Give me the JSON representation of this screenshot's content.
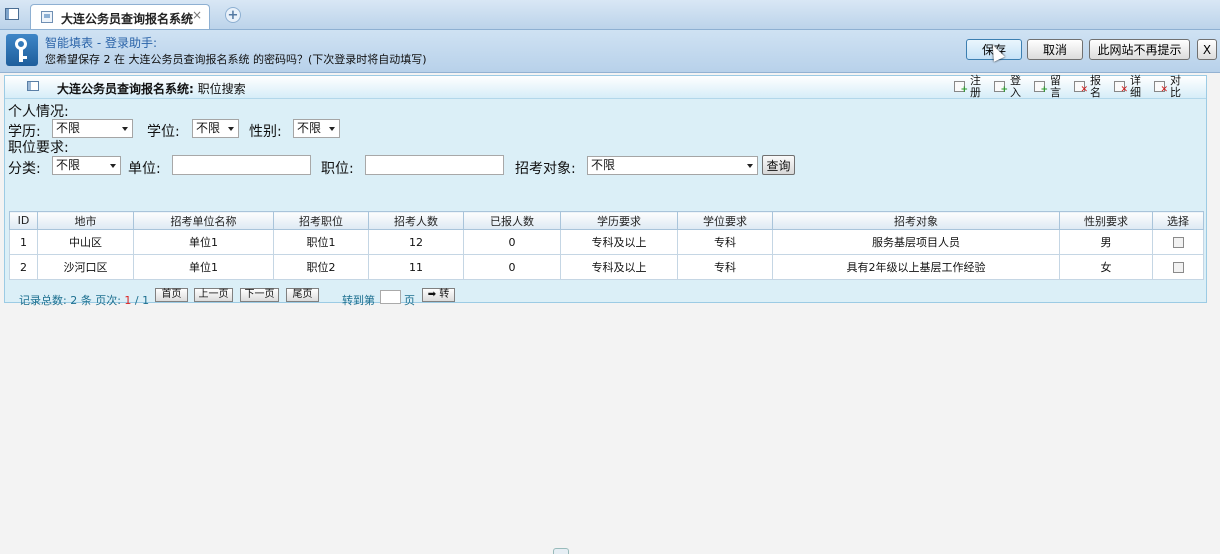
{
  "browser": {
    "tab_title": "大连公务员查询报名系统",
    "tab_close": "×",
    "newtab": "+"
  },
  "notification": {
    "title": "智能填表 - 登录助手:",
    "message": "您希望保存 2 在 大连公务员查询报名系统 的密码吗？(下次登录时将自动填写)",
    "save_label": "保存",
    "cancel_label": "取消",
    "never_label": "此网站不再提示",
    "close_label": "X"
  },
  "panel": {
    "title_system": "大连公务员查询报名系统:",
    "title_page": "职位搜索",
    "tools": [
      {
        "icon": "add-icon",
        "label": "注册"
      },
      {
        "icon": "add-icon",
        "label": "登入"
      },
      {
        "icon": "add-icon",
        "label": "留言"
      },
      {
        "icon": "delete-icon",
        "label": "报名"
      },
      {
        "icon": "delete-icon",
        "label": "详细"
      },
      {
        "icon": "delete-icon",
        "label": "对比"
      }
    ]
  },
  "form": {
    "personal_heading": "个人情况:",
    "education_label": "学历:",
    "education_value": "不限",
    "degree_label": "学位:",
    "degree_value": "不限",
    "gender_label": "性别:",
    "gender_value": "不限",
    "requirement_heading": "职位要求:",
    "category_label": "分类:",
    "category_value": "不限",
    "unit_label": "单位:",
    "unit_value": "",
    "position_label": "职位:",
    "position_value": "",
    "target_label": "招考对象:",
    "target_value": "不限",
    "query_label": "查询"
  },
  "table": {
    "headers": [
      "ID",
      "地市",
      "招考单位名称",
      "招考职位",
      "招考人数",
      "已报人数",
      "学历要求",
      "学位要求",
      "招考对象",
      "性别要求",
      "选择"
    ],
    "rows": [
      [
        "1",
        "中山区",
        "单位1",
        "职位1",
        "12",
        "0",
        "专科及以上",
        "专科",
        "服务基层项目人员",
        "男"
      ],
      [
        "2",
        "沙河口区",
        "单位1",
        "职位2",
        "11",
        "0",
        "专科及以上",
        "专科",
        "具有2年级以上基层工作经验",
        "女"
      ]
    ]
  },
  "pager": {
    "total_text": "记录总数: 2 条  页次: ",
    "current": "1",
    "total_pages": " / 1",
    "first": "首页",
    "prev": "上一页",
    "next": "下一页",
    "last": "尾页",
    "goto_label": "转到第",
    "goto_unit": "页",
    "go": "➡ 转"
  }
}
